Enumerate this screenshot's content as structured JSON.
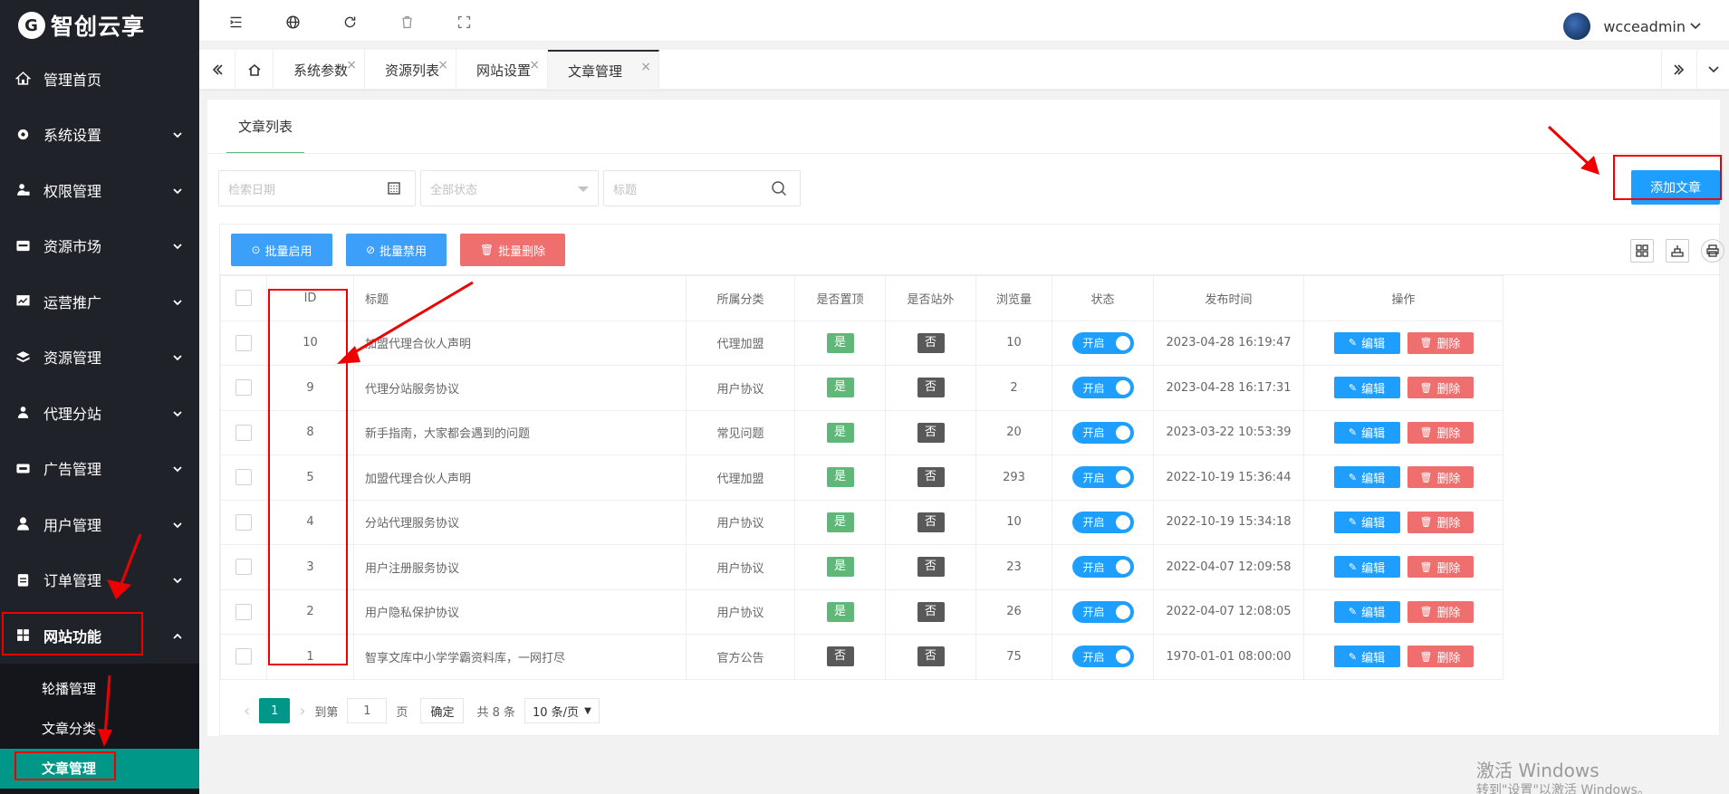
{
  "app": {
    "logo_text": "智创云享",
    "logo_mark": "G"
  },
  "sidebar": {
    "items": [
      {
        "label": "管理首页",
        "icon": "home-icon"
      },
      {
        "label": "系统设置",
        "icon": "gear-icon"
      },
      {
        "label": "权限管理",
        "icon": "user-lock-icon"
      },
      {
        "label": "资源市场",
        "icon": "inbox-icon"
      },
      {
        "label": "运营推广",
        "icon": "chart-icon"
      },
      {
        "label": "资源管理",
        "icon": "layers-icon"
      },
      {
        "label": "代理分站",
        "icon": "sitemap-icon"
      },
      {
        "label": "广告管理",
        "icon": "ad-icon"
      },
      {
        "label": "用户管理",
        "icon": "user-icon"
      },
      {
        "label": "订单管理",
        "icon": "clipboard-icon"
      },
      {
        "label": "网站功能",
        "icon": "apps-icon"
      }
    ],
    "submenu": [
      {
        "label": "轮播管理"
      },
      {
        "label": "文章分类"
      },
      {
        "label": "文章管理"
      }
    ]
  },
  "header": {
    "username": "wcceadmin"
  },
  "tabs": [
    {
      "label": "系统参数"
    },
    {
      "label": "资源列表"
    },
    {
      "label": "网站设置"
    },
    {
      "label": "文章管理"
    }
  ],
  "card": {
    "tab_label": "文章列表",
    "search": {
      "date_placeholder": "检索日期",
      "status_placeholder": "全部状态",
      "title_placeholder": "标题"
    },
    "add_button": "添加文章",
    "bulk": {
      "enable": "批量启用",
      "disable": "批量禁用",
      "delete": "批量删除"
    },
    "columns": [
      "ID",
      "标题",
      "所属分类",
      "是否置顶",
      "是否站外",
      "浏览量",
      "状态",
      "发布时间",
      "操作"
    ],
    "rows": [
      {
        "id": "10",
        "title": "加盟代理合伙人声明",
        "category": "代理加盟",
        "top": "是",
        "external": "否",
        "views": "10",
        "status": "开启",
        "time": "2023-04-28 16:19:47"
      },
      {
        "id": "9",
        "title": "代理分站服务协议",
        "category": "用户协议",
        "top": "是",
        "external": "否",
        "views": "2",
        "status": "开启",
        "time": "2023-04-28 16:17:31"
      },
      {
        "id": "8",
        "title": "新手指南，大家都会遇到的问题",
        "category": "常见问题",
        "top": "是",
        "external": "否",
        "views": "20",
        "status": "开启",
        "time": "2023-03-22 10:53:39"
      },
      {
        "id": "5",
        "title": "加盟代理合伙人声明",
        "category": "代理加盟",
        "top": "是",
        "external": "否",
        "views": "293",
        "status": "开启",
        "time": "2022-10-19 15:36:44"
      },
      {
        "id": "4",
        "title": "分站代理服务协议",
        "category": "用户协议",
        "top": "是",
        "external": "否",
        "views": "10",
        "status": "开启",
        "time": "2022-10-19 15:34:18"
      },
      {
        "id": "3",
        "title": "用户注册服务协议",
        "category": "用户协议",
        "top": "是",
        "external": "否",
        "views": "23",
        "status": "开启",
        "time": "2022-04-07 12:09:58"
      },
      {
        "id": "2",
        "title": "用户隐私保护协议",
        "category": "用户协议",
        "top": "是",
        "external": "否",
        "views": "26",
        "status": "开启",
        "time": "2022-04-07 12:08:05"
      },
      {
        "id": "1",
        "title": "智享文库中小学学霸资料库，一网打尽",
        "category": "官方公告",
        "top": "否",
        "external": "否",
        "views": "75",
        "status": "开启",
        "time": "1970-01-01 08:00:00"
      }
    ],
    "edit_label": "编辑",
    "delete_label": "删除",
    "pager": {
      "current": "1",
      "goto_label": "到第",
      "page_input": "1",
      "page_unit": "页",
      "confirm": "确定",
      "total": "共 8 条",
      "page_size": "10 条/页"
    }
  },
  "watermark": {
    "line1": "激活 Windows",
    "line2": "转到\"设置\"以激活 Windows。"
  },
  "colors": {
    "sidebar_bg": "#20222a",
    "active_green": "#009688",
    "primary_blue": "#1e9fff",
    "danger_red": "#ef6e6e",
    "annotation_red": "#ee0000"
  }
}
